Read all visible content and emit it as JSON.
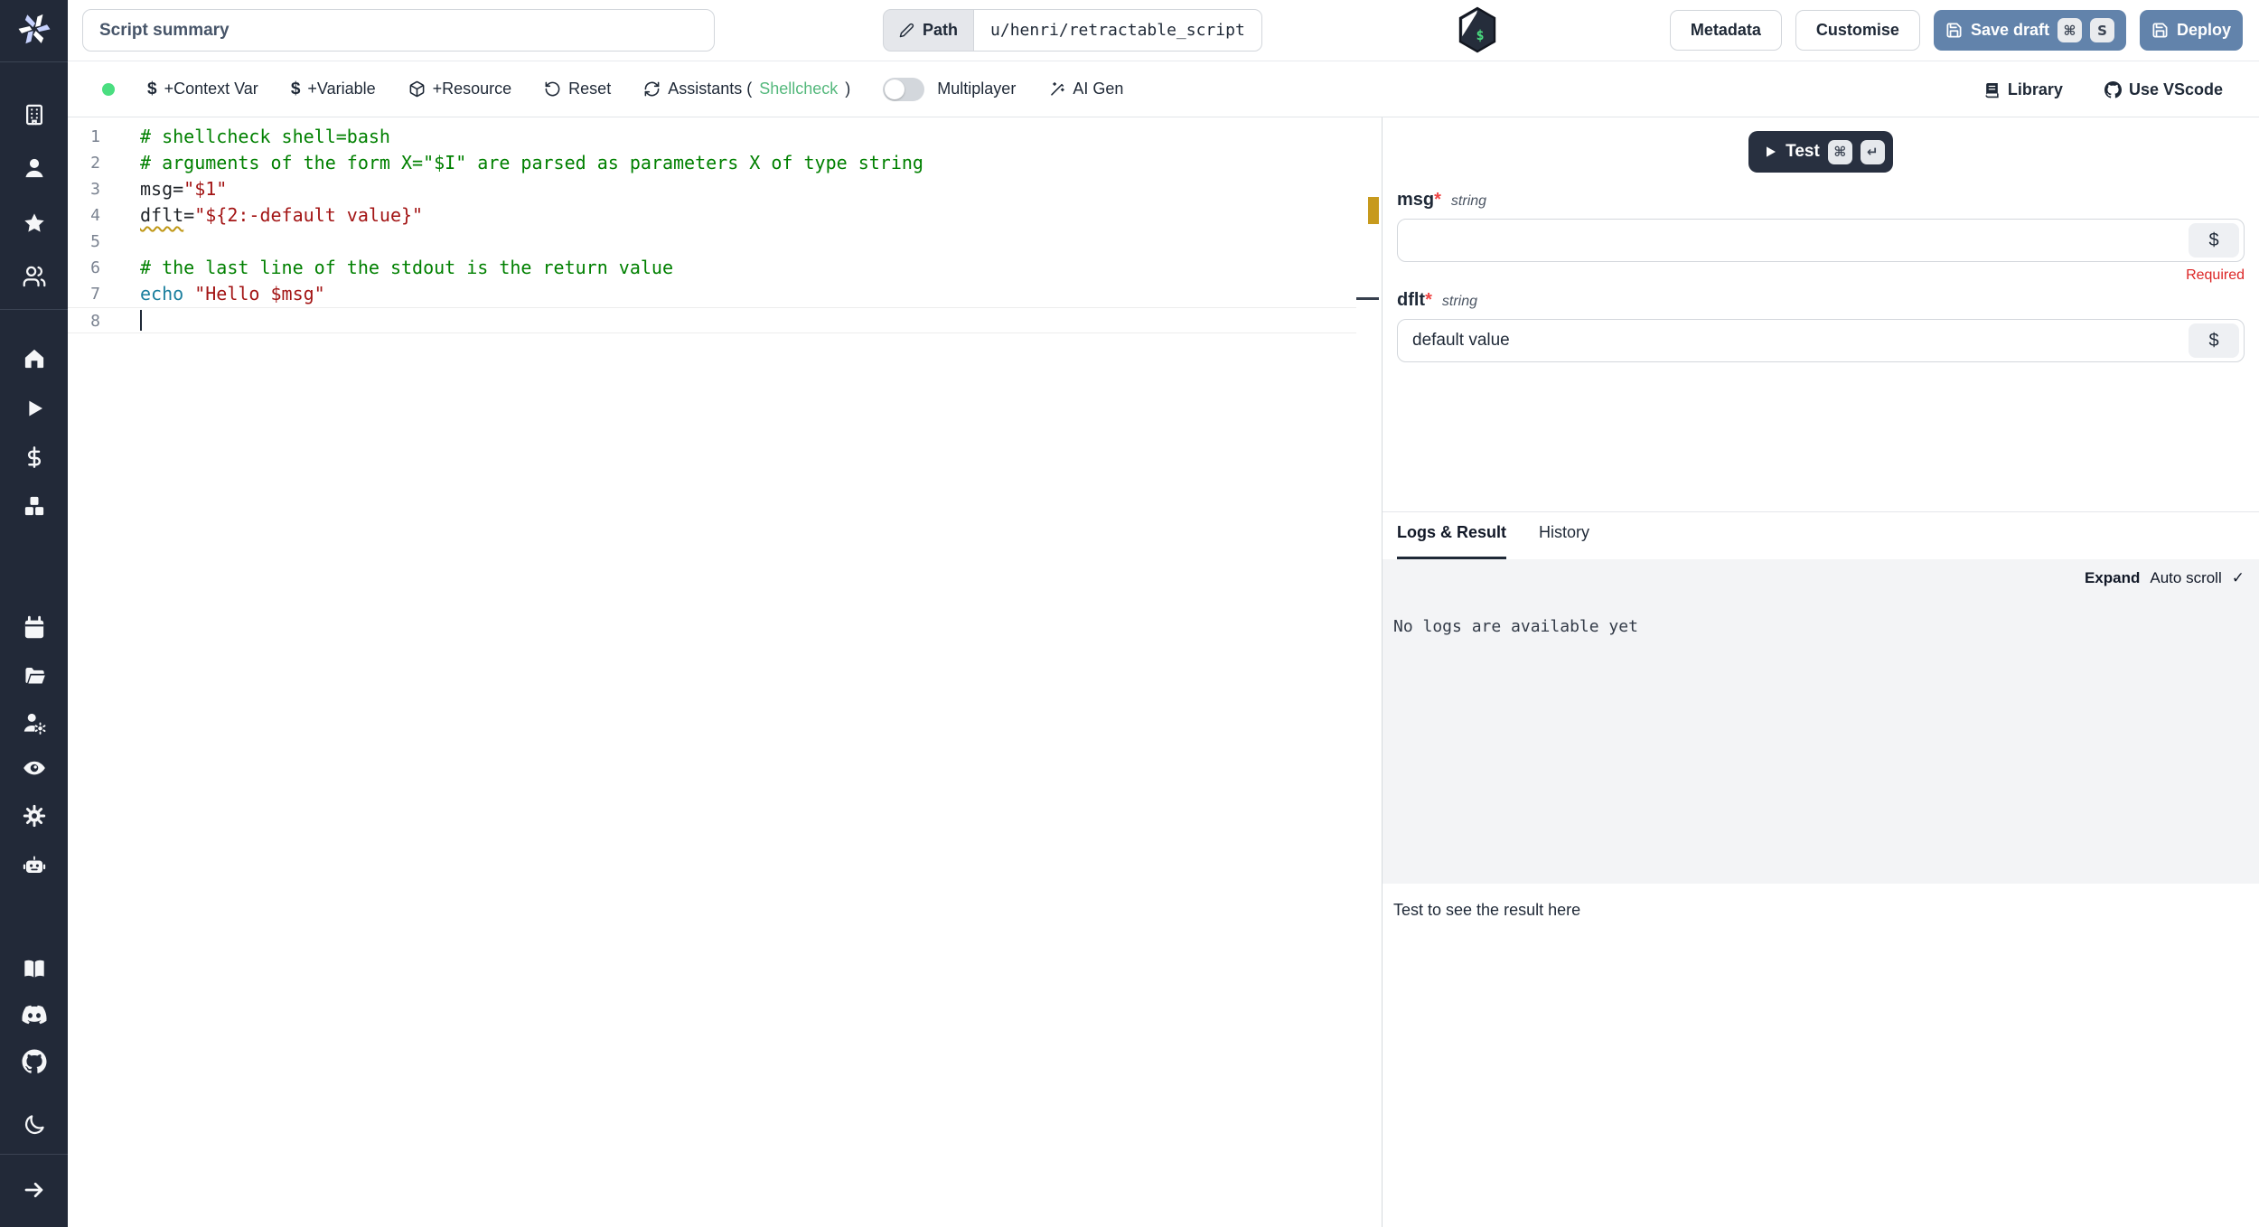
{
  "topbar": {
    "summary_value": "Script summary",
    "path_label": "Path",
    "path_value": "u/henri/retractable_script",
    "metadata_label": "Metadata",
    "customise_label": "Customise",
    "save_draft_label": "Save draft",
    "save_draft_kbd": [
      "⌘",
      "S"
    ],
    "deploy_label": "Deploy",
    "language_icon": "bash-hexagon-icon",
    "bash_symbol": "$"
  },
  "toolbar": {
    "status": "connected",
    "context_var_label": "+Context Var",
    "variable_label": "+Variable",
    "resource_label": "+Resource",
    "reset_label": "Reset",
    "assistants_prefix": "Assistants (",
    "assistants_lint": "Shellcheck",
    "assistants_suffix": ")",
    "multiplayer_label": "Multiplayer",
    "multiplayer_on": false,
    "ai_gen_label": "AI Gen",
    "library_label": "Library",
    "vscode_label": "Use VScode",
    "dollar_glyph": "$"
  },
  "editor": {
    "language": "bash",
    "lines": [
      {
        "num": 1,
        "tokens": [
          {
            "text": "# shellcheck shell=bash",
            "style": "comment"
          }
        ]
      },
      {
        "num": 2,
        "tokens": [
          {
            "text": "# arguments of the form X=\"$I\" are parsed as parameters X of type string",
            "style": "comment"
          }
        ]
      },
      {
        "num": 3,
        "tokens": [
          {
            "text": "msg=",
            "style": "plain"
          },
          {
            "text": "\"$1\"",
            "style": "string"
          }
        ]
      },
      {
        "num": 4,
        "tokens": [
          {
            "text": "dflt",
            "style": "plain warn"
          },
          {
            "text": "=",
            "style": "plain"
          },
          {
            "text": "\"${2:-default value}\"",
            "style": "string"
          }
        ]
      },
      {
        "num": 5,
        "tokens": []
      },
      {
        "num": 6,
        "tokens": [
          {
            "text": "# the last line of the stdout is the return value",
            "style": "comment"
          }
        ]
      },
      {
        "num": 7,
        "tokens": [
          {
            "text": "echo ",
            "style": "keyword"
          },
          {
            "text": "\"Hello $msg\"",
            "style": "string"
          }
        ]
      },
      {
        "num": 8,
        "tokens": [],
        "cursor": true
      }
    ]
  },
  "right_panel": {
    "test_label": "Test",
    "test_kbd": [
      "⌘",
      "↵"
    ],
    "dollar_suffix": "$",
    "args": [
      {
        "name": "msg",
        "star": "*",
        "type": "string",
        "value": "",
        "error": "Required"
      },
      {
        "name": "dflt",
        "star": "*",
        "type": "string",
        "value": "default value",
        "error": ""
      }
    ],
    "tabs": {
      "logs": "Logs & Result",
      "history": "History"
    },
    "expand_label": "Expand",
    "autoscroll_label": "Auto scroll",
    "autoscroll_check": "✓",
    "no_logs_text": "No logs are available yet",
    "result_placeholder": "Test to see the result here"
  },
  "sidebar": {
    "icons": [
      "building-icon",
      "user-icon",
      "star-icon",
      "users-icon",
      "home-icon",
      "play-icon",
      "dollar-icon",
      "boxes-icon",
      "calendar-icon",
      "folder-open-icon",
      "user-cog-icon",
      "eye-icon",
      "settings-icon",
      "bot-icon",
      "book-open-icon",
      "discord-icon",
      "github-icon",
      "moon-icon",
      "arrow-right-icon"
    ]
  },
  "colors": {
    "sidebar_bg": "#222938",
    "accent_button": "#6283ab",
    "test_button": "#283040",
    "success_green": "#4ade80",
    "shellcheck_green": "#54b87c",
    "required_red": "#dc2626",
    "comment_green": "#008000",
    "string_red": "#a31515",
    "keyword_teal": "#1b7f9e",
    "warning_marker": "#c79a1d"
  }
}
